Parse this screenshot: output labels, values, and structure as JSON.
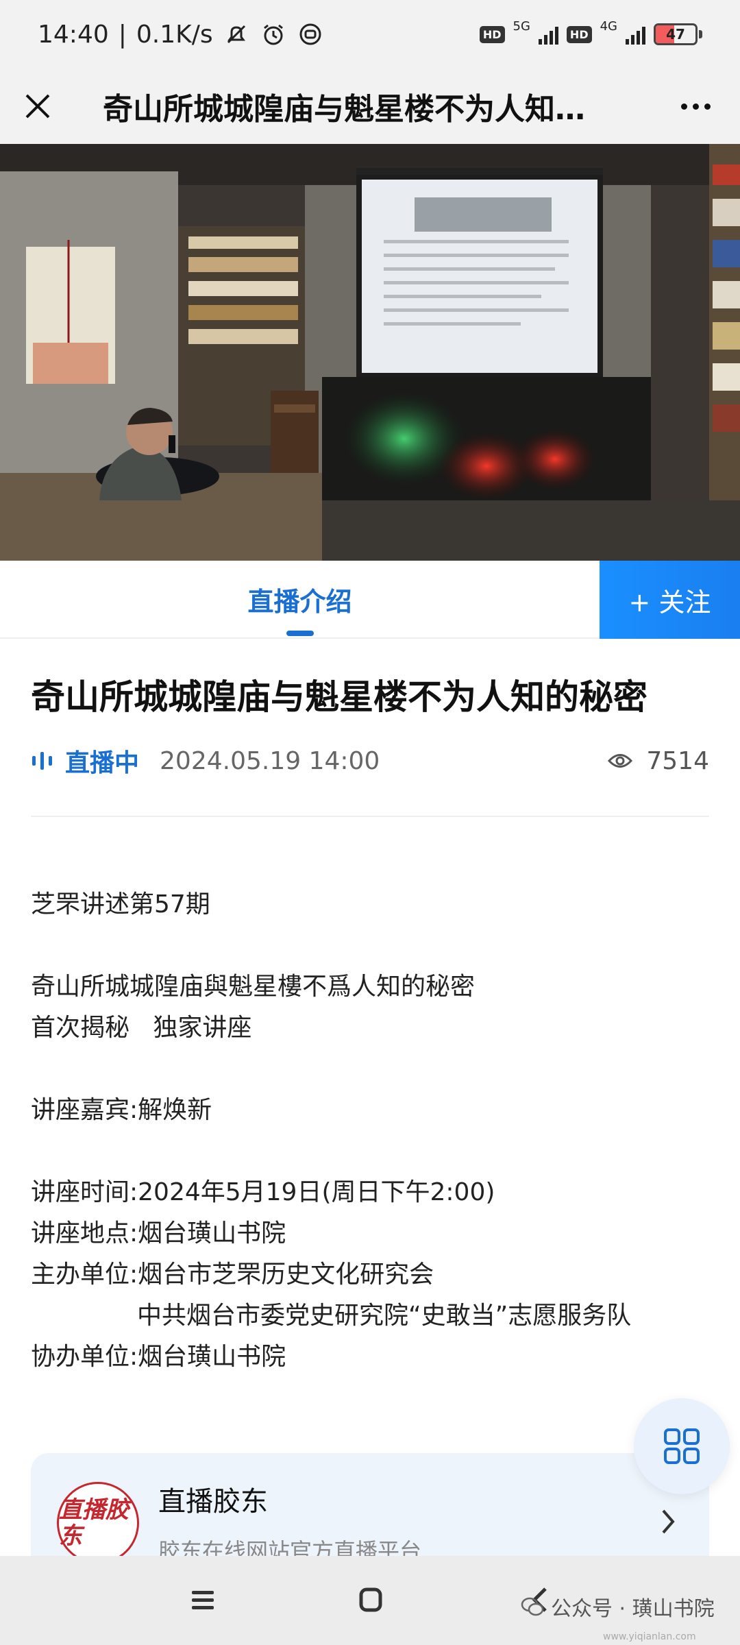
{
  "status_bar": {
    "time": "14:40",
    "speed": "0.1K/s",
    "hd1": "HD",
    "net1": "5G",
    "hd2": "HD",
    "net2": "4G",
    "battery": "47",
    "battery_level": 0.47,
    "icons": [
      "mute-icon",
      "alarm-icon",
      "app-status-icon"
    ]
  },
  "header": {
    "title": "奇山所城城隍庙与魁星楼不为人知…"
  },
  "hero_image": {
    "description_icon": "lecture-photo"
  },
  "tabs": {
    "intro_label": "直播介绍",
    "follow_label": "+ 关注"
  },
  "article": {
    "title": "奇山所城城隍庙与魁星楼不为人知的秘密",
    "live_status": "直播中",
    "date": "2024.05.19 14:00",
    "views": "7514"
  },
  "content": {
    "line1": "芝罘讲述第57期",
    "line2": "奇山所城城隍庙與魁星樓不爲人知的秘密",
    "line3": "首次揭秘   独家讲座",
    "line4": "讲座嘉宾:解焕新",
    "line5": "讲座时间:2024年5月19日(周日下午2:00)",
    "line6": "讲座地点:烟台璜山书院",
    "line7": "主办单位:烟台市芝罘历史文化研究会",
    "line8": "中共烟台市委党史研究院“史敢当”志愿服务队",
    "line9": "协办单位:烟台璜山书院"
  },
  "channel": {
    "logo_text": "直播胶东",
    "name": "直播胶东",
    "description": "胶东在线网站官方直播平台"
  },
  "watermark": {
    "text": "公众号 · 璜山书院",
    "url": "www.yiqianlan.com"
  },
  "colors": {
    "accent": "#1a6fd3",
    "follow_bg": "#1a8fff",
    "card_bg": "#eef4fb",
    "logo_red": "#c6262e"
  }
}
